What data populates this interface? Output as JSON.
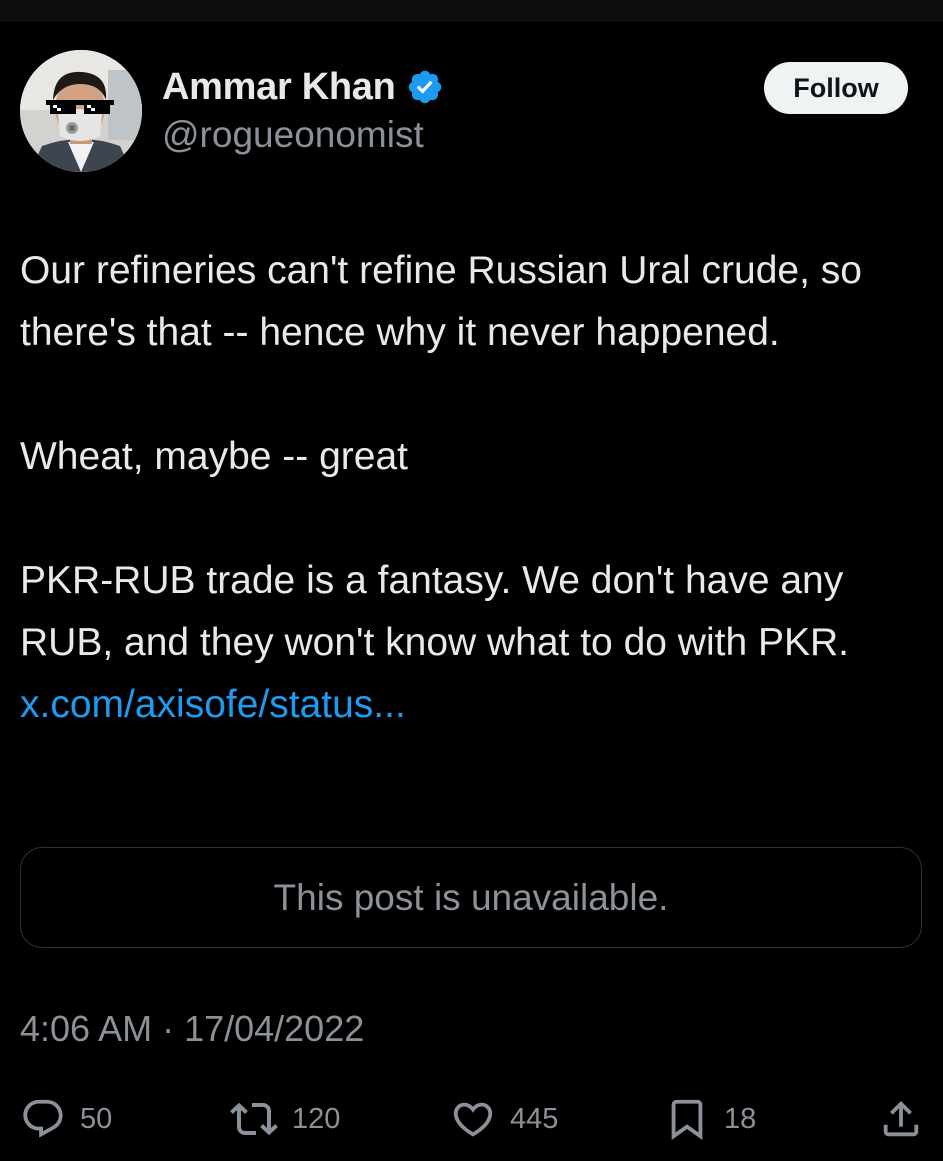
{
  "author": {
    "name": "Ammar Khan",
    "handle": "@rogueonomist",
    "verified": true,
    "avatar_icon": "profile-photo-with-mask-and-pixel-sunglasses"
  },
  "follow_label": "Follow",
  "tweet": {
    "paragraph_1": "Our refineries can't refine Russian Ural crude, so there's that -- hence why it never happened.",
    "paragraph_2": "Wheat, maybe -- great",
    "paragraph_3_text": "PKR-RUB trade is a fantasy. We don't have any RUB, and they won't know what to do with PKR.",
    "link_text": "x.com/axisofe/status..."
  },
  "quote": {
    "text": "This post is unavailable."
  },
  "timestamp": "4:06 AM · 17/04/2022",
  "actions": {
    "replies": "50",
    "reposts": "120",
    "likes": "445",
    "bookmarks": "18"
  },
  "colors": {
    "background": "#000000",
    "text_primary": "#e7e9ea",
    "text_secondary": "#8b9199",
    "link": "#1d9bf0",
    "verified": "#1d9bf0",
    "follow_bg": "#eff3f4",
    "border": "#2f3336"
  },
  "icons": {
    "reply": "reply-icon",
    "repost": "repost-icon",
    "like": "heart-icon",
    "bookmark": "bookmark-icon",
    "share": "share-icon"
  }
}
